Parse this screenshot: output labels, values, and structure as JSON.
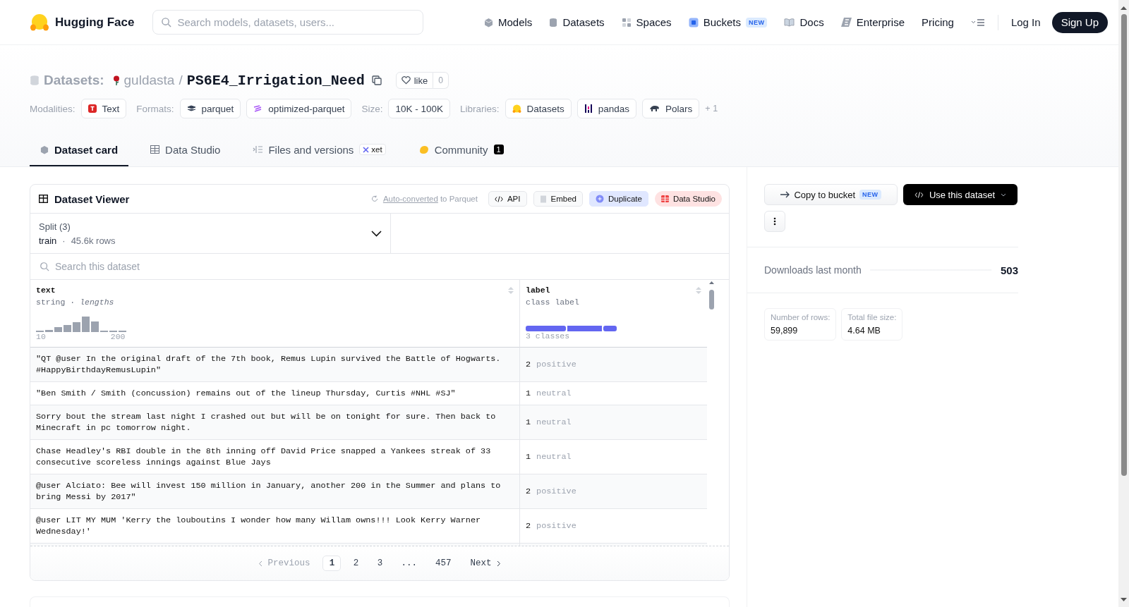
{
  "header": {
    "logo_text": "Hugging Face",
    "search": {
      "placeholder": "Search models, datasets, users..."
    },
    "nav": [
      {
        "label": "Models",
        "kind": "models"
      },
      {
        "label": "Datasets",
        "kind": "datasets"
      },
      {
        "label": "Spaces",
        "kind": "spaces"
      },
      {
        "label": "Buckets",
        "kind": "buckets",
        "badge": "NEW"
      },
      {
        "label": "Docs",
        "kind": "docs"
      },
      {
        "label": "Enterprise",
        "kind": "enterprise"
      },
      {
        "label": "Pricing",
        "kind": "plain"
      }
    ],
    "login": "Log In",
    "signup": "Sign Up"
  },
  "dataset": {
    "category": "Datasets:",
    "owner": "guldasta",
    "slash": "/",
    "name": "PS6E4_Irrigation_Need",
    "like": "like",
    "like_count": "0"
  },
  "tag_groups": [
    {
      "label": "Modalities:",
      "items": [
        {
          "text": "Text",
          "kind": "text"
        }
      ]
    },
    {
      "label": "Formats:",
      "items": [
        {
          "text": "parquet",
          "kind": "parquet"
        },
        {
          "text": "optimized-parquet",
          "kind": "optimized"
        }
      ]
    },
    {
      "label": "Size:",
      "items": [
        {
          "text": "10K - 100K",
          "kind": "plain"
        }
      ]
    },
    {
      "label": "Libraries:",
      "items": [
        {
          "text": "Datasets",
          "kind": "hf"
        },
        {
          "text": "pandas",
          "kind": "pandas"
        },
        {
          "text": "Polars",
          "kind": "polars"
        }
      ],
      "more": "+ 1"
    }
  ],
  "tabs": [
    {
      "label": "Dataset card",
      "kind": "card",
      "selected": true
    },
    {
      "label": "Data Studio",
      "kind": "studio",
      "selected": false
    },
    {
      "label": "Files and versions",
      "kind": "files",
      "selected": false,
      "badge": "xet"
    },
    {
      "label": "Community",
      "kind": "community",
      "selected": false,
      "count": "1"
    }
  ],
  "viewer": {
    "title": "Dataset Viewer",
    "converted_link": "Auto-converted",
    "converted_text": "to Parquet",
    "buttons": [
      {
        "label": "API",
        "kind": "api"
      },
      {
        "label": "Embed",
        "kind": "embed"
      },
      {
        "label": "Duplicate",
        "kind": "duplicate"
      },
      {
        "label": "Data Studio",
        "kind": "studio"
      }
    ],
    "split": {
      "label": "Split (3)",
      "value": "train",
      "separator": "·",
      "rows": "45.6k rows"
    },
    "search": {
      "placeholder": "Search this dataset"
    },
    "columns": [
      {
        "name": "text",
        "type": "string · *lengths*",
        "axis_min": "10",
        "axis_max": "200",
        "kind": "histogram"
      },
      {
        "name": "label",
        "type": "class label",
        "summary": "3 classes",
        "kind": "classes"
      }
    ],
    "rows": [
      {
        "text": "\"QT @user In the original draft of the 7th book, Remus Lupin survived the Battle of Hogwarts. #HappyBirthdayRemusLupin\"",
        "label_id": "2",
        "label": "positive"
      },
      {
        "text": "\"Ben Smith / Smith (concussion) remains out of the lineup Thursday, Curtis #NHL #SJ\"",
        "label_id": "1",
        "label": "neutral"
      },
      {
        "text": "Sorry bout the stream last night I crashed out but will be on tonight for sure. Then back to Minecraft in pc tomorrow night.",
        "label_id": "1",
        "label": "neutral"
      },
      {
        "text": "Chase Headley's RBI double in the 8th inning off David Price snapped a Yankees streak of 33 consecutive scoreless innings against Blue Jays",
        "label_id": "1",
        "label": "neutral"
      },
      {
        "text": "@user Alciato: Bee will invest 150 million in January, another 200 in the Summer and plans to bring Messi by 2017\"",
        "label_id": "2",
        "label": "positive"
      },
      {
        "text": "@user LIT MY MUM 'Kerry the louboutins I wonder how many Willam owns!!! Look Kerry Warner Wednesday!'",
        "label_id": "2",
        "label": "positive"
      }
    ],
    "pagination": {
      "previous": {
        "label": "Previous",
        "disabled": true
      },
      "pages": [
        {
          "label": "1",
          "selected": true
        },
        {
          "label": "2",
          "selected": false
        },
        {
          "label": "3",
          "selected": false
        },
        {
          "label": "...",
          "selected": false
        },
        {
          "label": "457",
          "selected": false
        }
      ],
      "next": {
        "label": "Next",
        "disabled": false
      }
    }
  },
  "sidebar": {
    "copy_button": "Copy to bucket",
    "copy_badge": "NEW",
    "use_button": "Use this dataset",
    "downloads_label": "Downloads last month",
    "downloads_value": "503",
    "stats": [
      {
        "label": "Number of rows:",
        "value": "59,899"
      },
      {
        "label": "Total file size:",
        "value": "4.64 MB"
      }
    ]
  }
}
